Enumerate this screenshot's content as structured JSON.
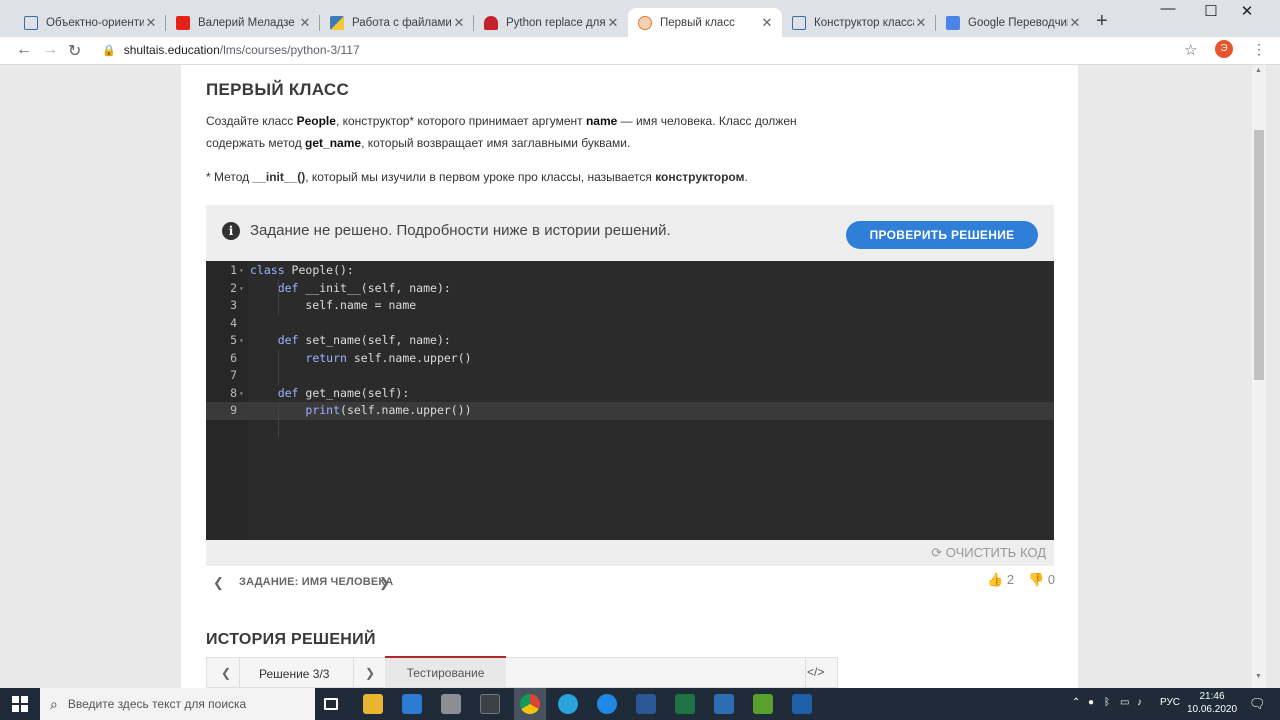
{
  "browser": {
    "tabs": [
      {
        "title": "Объектно-ориентиров",
        "icon": "doc-icon",
        "color": "#3b6ea5"
      },
      {
        "title": "Валерий Меладзе - Но",
        "icon": "youtube-icon",
        "color": "#e62117"
      },
      {
        "title": "Работа с файлами в Py",
        "icon": "python-icon",
        "color": "#3d7ab8"
      },
      {
        "title": "Python replace для стр",
        "icon": "snake-icon",
        "color": "#c5212b"
      },
      {
        "title": "Первый класс",
        "icon": "shultais-icon",
        "color": "#e07a2a"
      },
      {
        "title": "Конструктор класса – и",
        "icon": "doc-icon",
        "color": "#3b6ea5"
      },
      {
        "title": "Google Переводчик",
        "icon": "translate-icon",
        "color": "#4a86e8"
      }
    ],
    "url_domain": "shultais.education",
    "url_path": "/lms/courses/python-3/117",
    "profile_letter": "Э"
  },
  "page": {
    "title": "ПЕРВЫЙ КЛАСС",
    "desc": {
      "p1": "Создайте класс ",
      "b1": "People",
      "p2": ", конструктор* которого принимает аргумент ",
      "b2": "name",
      "p3": " — имя человека. Класс должен содержать метод ",
      "b3": "get_name",
      "p4": ", который возвращает имя заглавными буквами."
    },
    "footnote": {
      "p1": "* Метод ",
      "b1": "__init__()",
      "p2": ", который мы изучили в первом уроке про классы, называется ",
      "b2": "конструктором",
      "p3": "."
    },
    "status_text": "Задание не решено. Подробности ниже в истории решений.",
    "check_button": "ПРОВЕРИТЬ РЕШЕНИЕ",
    "clear_code": "ОЧИСТИТЬ КОД",
    "task_name": "ЗАДАНИЕ: ИМЯ ЧЕЛОВЕКА",
    "likes": "2",
    "dislikes": "0",
    "history_title": "ИСТОРИЯ РЕШЕНИЙ",
    "history": {
      "label": "Решение 3/3",
      "tab": "Тестирование",
      "code_icon": "</>"
    }
  },
  "code_lines": [
    {
      "n": "1",
      "text": "class People():"
    },
    {
      "n": "2",
      "text": "    def __init__(self, name):"
    },
    {
      "n": "3",
      "text": "        self.name = name"
    },
    {
      "n": "4",
      "text": ""
    },
    {
      "n": "5",
      "text": "    def set_name(self, name):"
    },
    {
      "n": "6",
      "text": "        return self.name.upper()"
    },
    {
      "n": "7",
      "text": ""
    },
    {
      "n": "8",
      "text": "    def get_name(self):"
    },
    {
      "n": "9",
      "text": "        print(self.name.upper())"
    }
  ],
  "taskbar": {
    "search_placeholder": "Введите здесь текст для поиска",
    "lang": "РУС",
    "time": "21:46",
    "date": "10.06.2020"
  },
  "colors": {
    "accent": "#2f7ed8",
    "editor_bg": "#2b2b2b",
    "keyword": "#9eb2ff"
  }
}
